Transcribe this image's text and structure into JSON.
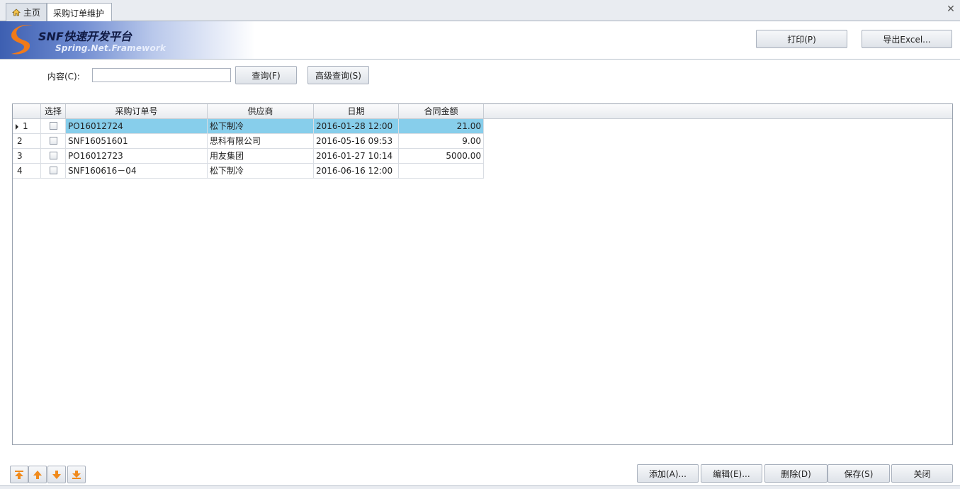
{
  "tabs": [
    {
      "label": "主页",
      "icon": "home-icon"
    },
    {
      "label": "采购订单维护"
    }
  ],
  "banner": {
    "title": "SNF快速开发平台",
    "subtitle": "Spring.Net.Framework"
  },
  "toolbar": {
    "print_label": "打印(P)",
    "export_label": "导出Excel..."
  },
  "search": {
    "label": "内容(C):",
    "value": "",
    "query_label": "查询(F)",
    "advanced_label": "高级查询(S)"
  },
  "grid": {
    "columns": [
      "选择",
      "采购订单号",
      "供应商",
      "日期",
      "合同金额"
    ],
    "rows": [
      {
        "index": "1",
        "order_no": "PO16012724",
        "supplier": "松下制冷",
        "date": "2016-01-28 12:00",
        "amount": "21.00",
        "selected": true
      },
      {
        "index": "2",
        "order_no": "SNF16051601",
        "supplier": "思科有限公司",
        "date": "2016-05-16 09:53",
        "amount": "9.00",
        "selected": false
      },
      {
        "index": "3",
        "order_no": "PO16012723",
        "supplier": "用友集团",
        "date": "2016-01-27 10:14",
        "amount": "5000.00",
        "selected": false
      },
      {
        "index": "4",
        "order_no": "SNF160616－04",
        "supplier": "松下制冷",
        "date": "2016-06-16 12:00",
        "amount": "",
        "selected": false
      }
    ]
  },
  "bottom": {
    "add_label": "添加(A)...",
    "edit_label": "编辑(E)...",
    "delete_label": "删除(D)",
    "save_label": "保存(S)",
    "close_label": "关闭"
  },
  "colors": {
    "selected_row": "#87ceeb",
    "nav_arrow": "#f08a1c"
  }
}
